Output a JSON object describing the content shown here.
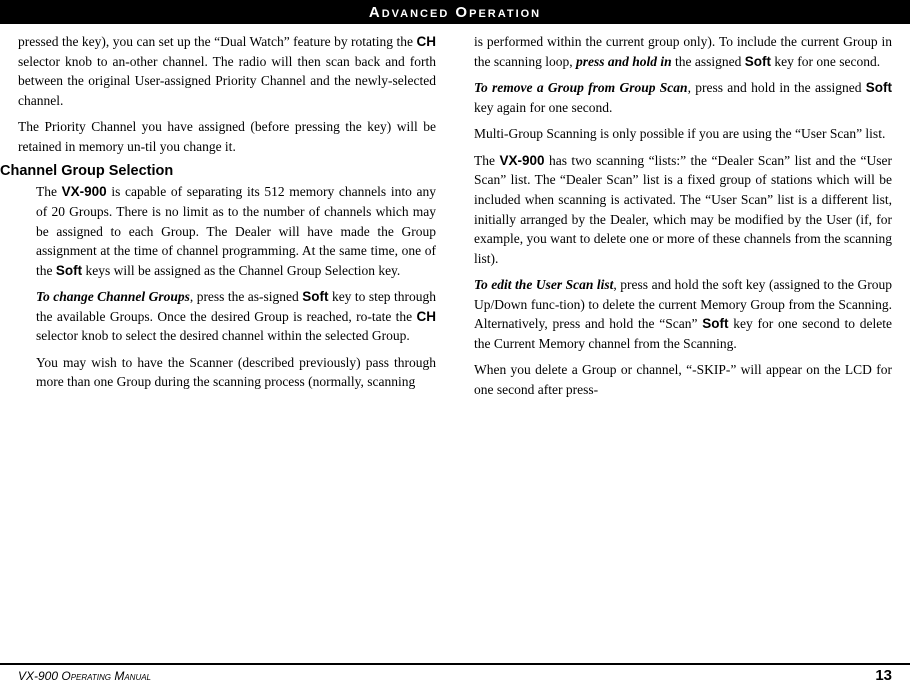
{
  "header": {
    "title": "Advanced  Operation"
  },
  "left_col": {
    "para1": "pressed the key), you can set up the “Dual Watch” feature by rotating the ",
    "para1_ch": "CH",
    "para1_rest": " selector knob to an-other channel. The radio will then scan back and forth between the original User-assigned Priority Channel and the newly-selected channel.",
    "para2": "The Priority Channel you have assigned (before pressing the key) will be retained in memory un-til you change it.",
    "section_heading": "Channel Group Selection",
    "para3_start": "The ",
    "para3_model": "VX-900",
    "para3_rest": " is capable of separating its 512 memory channels  into any of 20 Groups. There is no limit as to the number of channels which may be assigned to each Group. The Dealer will have made the Group assignment at the time of channel programming. At the same time, one of the ",
    "para3_soft": "Soft",
    "para3_end": " keys will be assigned as the Channel Group Selection key.",
    "para4_italic": "To change Channel Groups",
    "para4_rest": ", press the as-signed ",
    "para4_soft": "Soft",
    "para4_rest2": " key to step through the available Groups. Once the desired Group is reached, ro-tate the ",
    "para4_ch": "CH",
    "para4_end": " selector knob to select the desired channel within the selected Group.",
    "para5": "You may wish to have the Scanner (described previously) pass through more than one Group during the scanning process (normally, scanning"
  },
  "right_col": {
    "para1": "is performed within the current group only). To include the current Group in the scanning loop, ",
    "para1_bold_italic": "press and hold in",
    "para1_rest": " the assigned ",
    "para1_soft": "Soft",
    "para1_end": " key for one second.",
    "para2_italic": "To remove a Group from Group Scan",
    "para2_rest": ", press and hold in the assigned ",
    "para2_soft": "Soft",
    "para2_end": " key again for one second.",
    "para3": "Multi-Group Scanning is only possible if you are using the “User Scan” list.",
    "para4_start": "The ",
    "para4_model": "VX-900",
    "para4_rest": " has two scanning “lists:” the “Dealer Scan” list and the “User Scan” list. The “Dealer Scan” list is a fixed group of stations which will be included when scanning is activated. The “User Scan” list is a different list, initially arranged by the Dealer, which may be modified by the User (if, for example, you want to delete one or more of these channels from the scanning list).",
    "para5_italic": "To edit the User Scan list",
    "para5_rest": ", press and hold the soft key (assigned to the Group Up/Down func-tion) to delete the current Memory Group from the Scanning. Alternatively, press and hold the “Scan” ",
    "para5_soft": "Soft",
    "para5_end": " key for one second to delete the Current Memory channel from the Scanning.",
    "para6": "When you delete a Group or channel, “-SKIP-” will appear on the LCD for one second after press-"
  },
  "footer": {
    "left": "VX-900 Operating Manual",
    "right": "13"
  }
}
